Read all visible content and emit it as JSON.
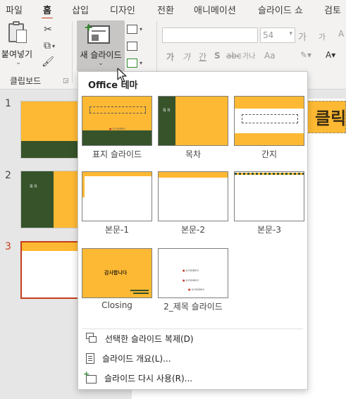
{
  "ribbon_tabs": [
    "파일",
    "홈",
    "삽입",
    "디자인",
    "전환",
    "애니메이션",
    "슬라이드 쇼",
    "검토"
  ],
  "active_tab": "홈",
  "clipboard": {
    "paste_label": "붙여넣기",
    "group_label": "클립보드"
  },
  "slides_group": {
    "new_slide_label": "새 슬라이드"
  },
  "font_group": {
    "font_name": "",
    "font_size": "54",
    "grow_font": "가",
    "shrink_font": "가",
    "bold": "가",
    "italic": "가",
    "underline": "간",
    "shadow": "S",
    "char_spacing": "가나",
    "change_case": "Aa"
  },
  "slide_pane": {
    "slide_numbers": [
      "1",
      "2",
      "3"
    ],
    "active_slide": "3",
    "slide2_title": "목 차",
    "title_placeholder_text": "클릭"
  },
  "layout_gallery": {
    "theme_title": "Office 테마",
    "layouts": [
      {
        "name": "표지 슬라이드",
        "logo": "a.makers"
      },
      {
        "name": "목차",
        "text": "목 차"
      },
      {
        "name": "간지"
      },
      {
        "name": "본문-1"
      },
      {
        "name": "본문-2"
      },
      {
        "name": "본문-3"
      },
      {
        "name": "Closing",
        "text": "감사합니다"
      },
      {
        "name": "2_제목 슬라이드",
        "logo": "a.makers"
      }
    ]
  },
  "menu": {
    "duplicate": "선택한 슬라이드 복제(D)",
    "outline": "슬라이드 개요(L)...",
    "reuse": "슬라이드 다시 사용(R)..."
  },
  "colors": {
    "accent": "#c43e1c",
    "gold": "#fdb933",
    "dark_green": "#36532a"
  }
}
